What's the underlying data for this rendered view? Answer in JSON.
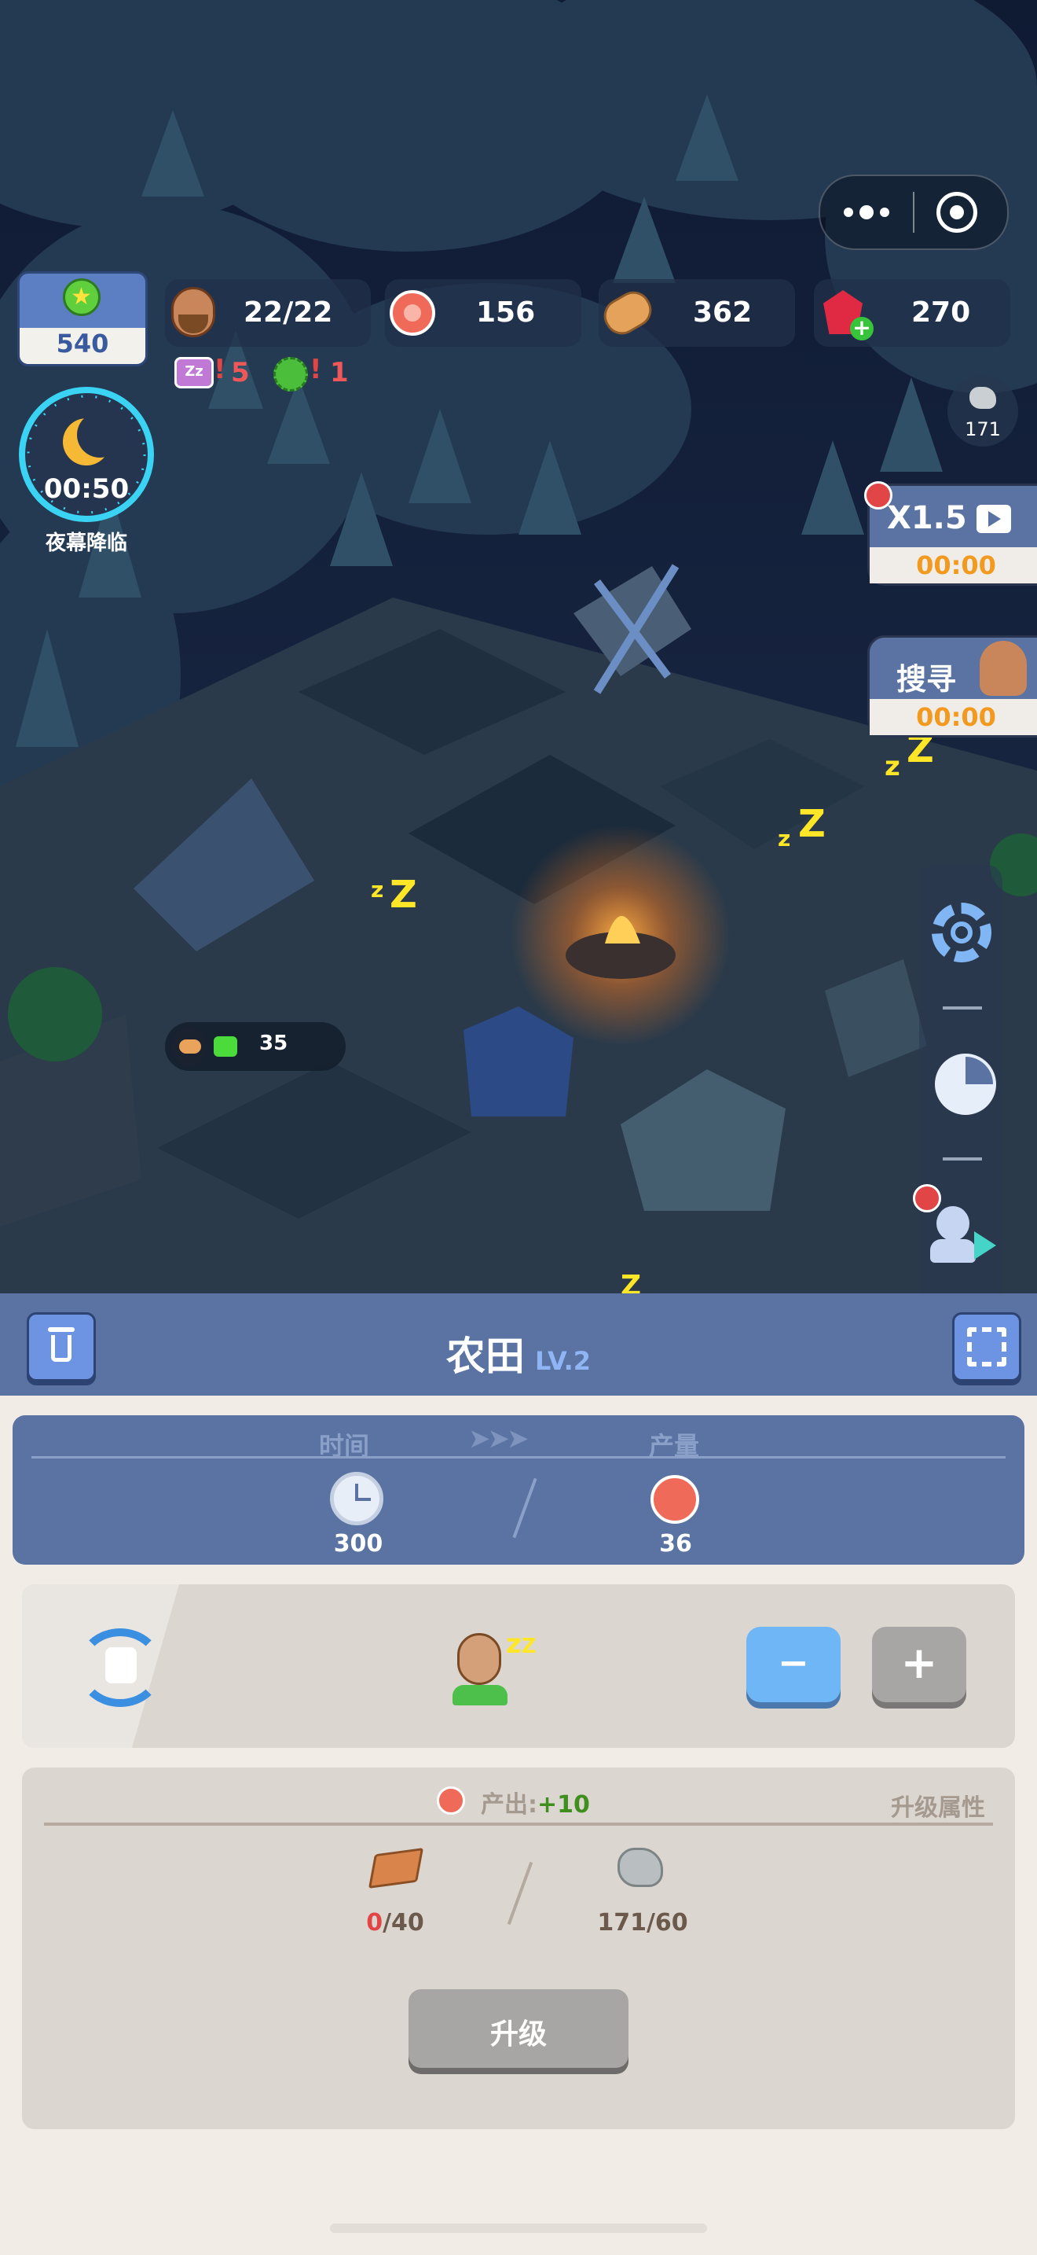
{
  "hud": {
    "rank_value": "540",
    "population": "22/22",
    "meat": "156",
    "wood": "362",
    "gems": "270",
    "sleep_count": "5",
    "sick_count": "1",
    "night_timer": "00:50",
    "night_label": "夜幕降临",
    "stone_count": "171",
    "boost_label": "X1.5",
    "boost_timer": "00:00",
    "search_label": "搜寻",
    "search_timer": "00:00",
    "worker_count": "35"
  },
  "colors": {
    "accent_blue": "#6d93e3",
    "header_blue": "#5a73a2",
    "green": "#3f8f1e",
    "red": "#e24545",
    "gold": "#f2b635"
  },
  "panel": {
    "title": "农田",
    "level": "LV.2",
    "production": {
      "time_label": "时间",
      "output_label": "产量",
      "time_value": "300",
      "output_value": "36"
    },
    "workers": {
      "minus_label": "−",
      "plus_label": "+"
    },
    "upgrade": {
      "output_label": "产出:",
      "output_bonus": "+10",
      "attr_label": "升级属性",
      "wood_have": "0",
      "wood_need": "/40",
      "stone_req": "171/60",
      "button_label": "升级"
    }
  }
}
